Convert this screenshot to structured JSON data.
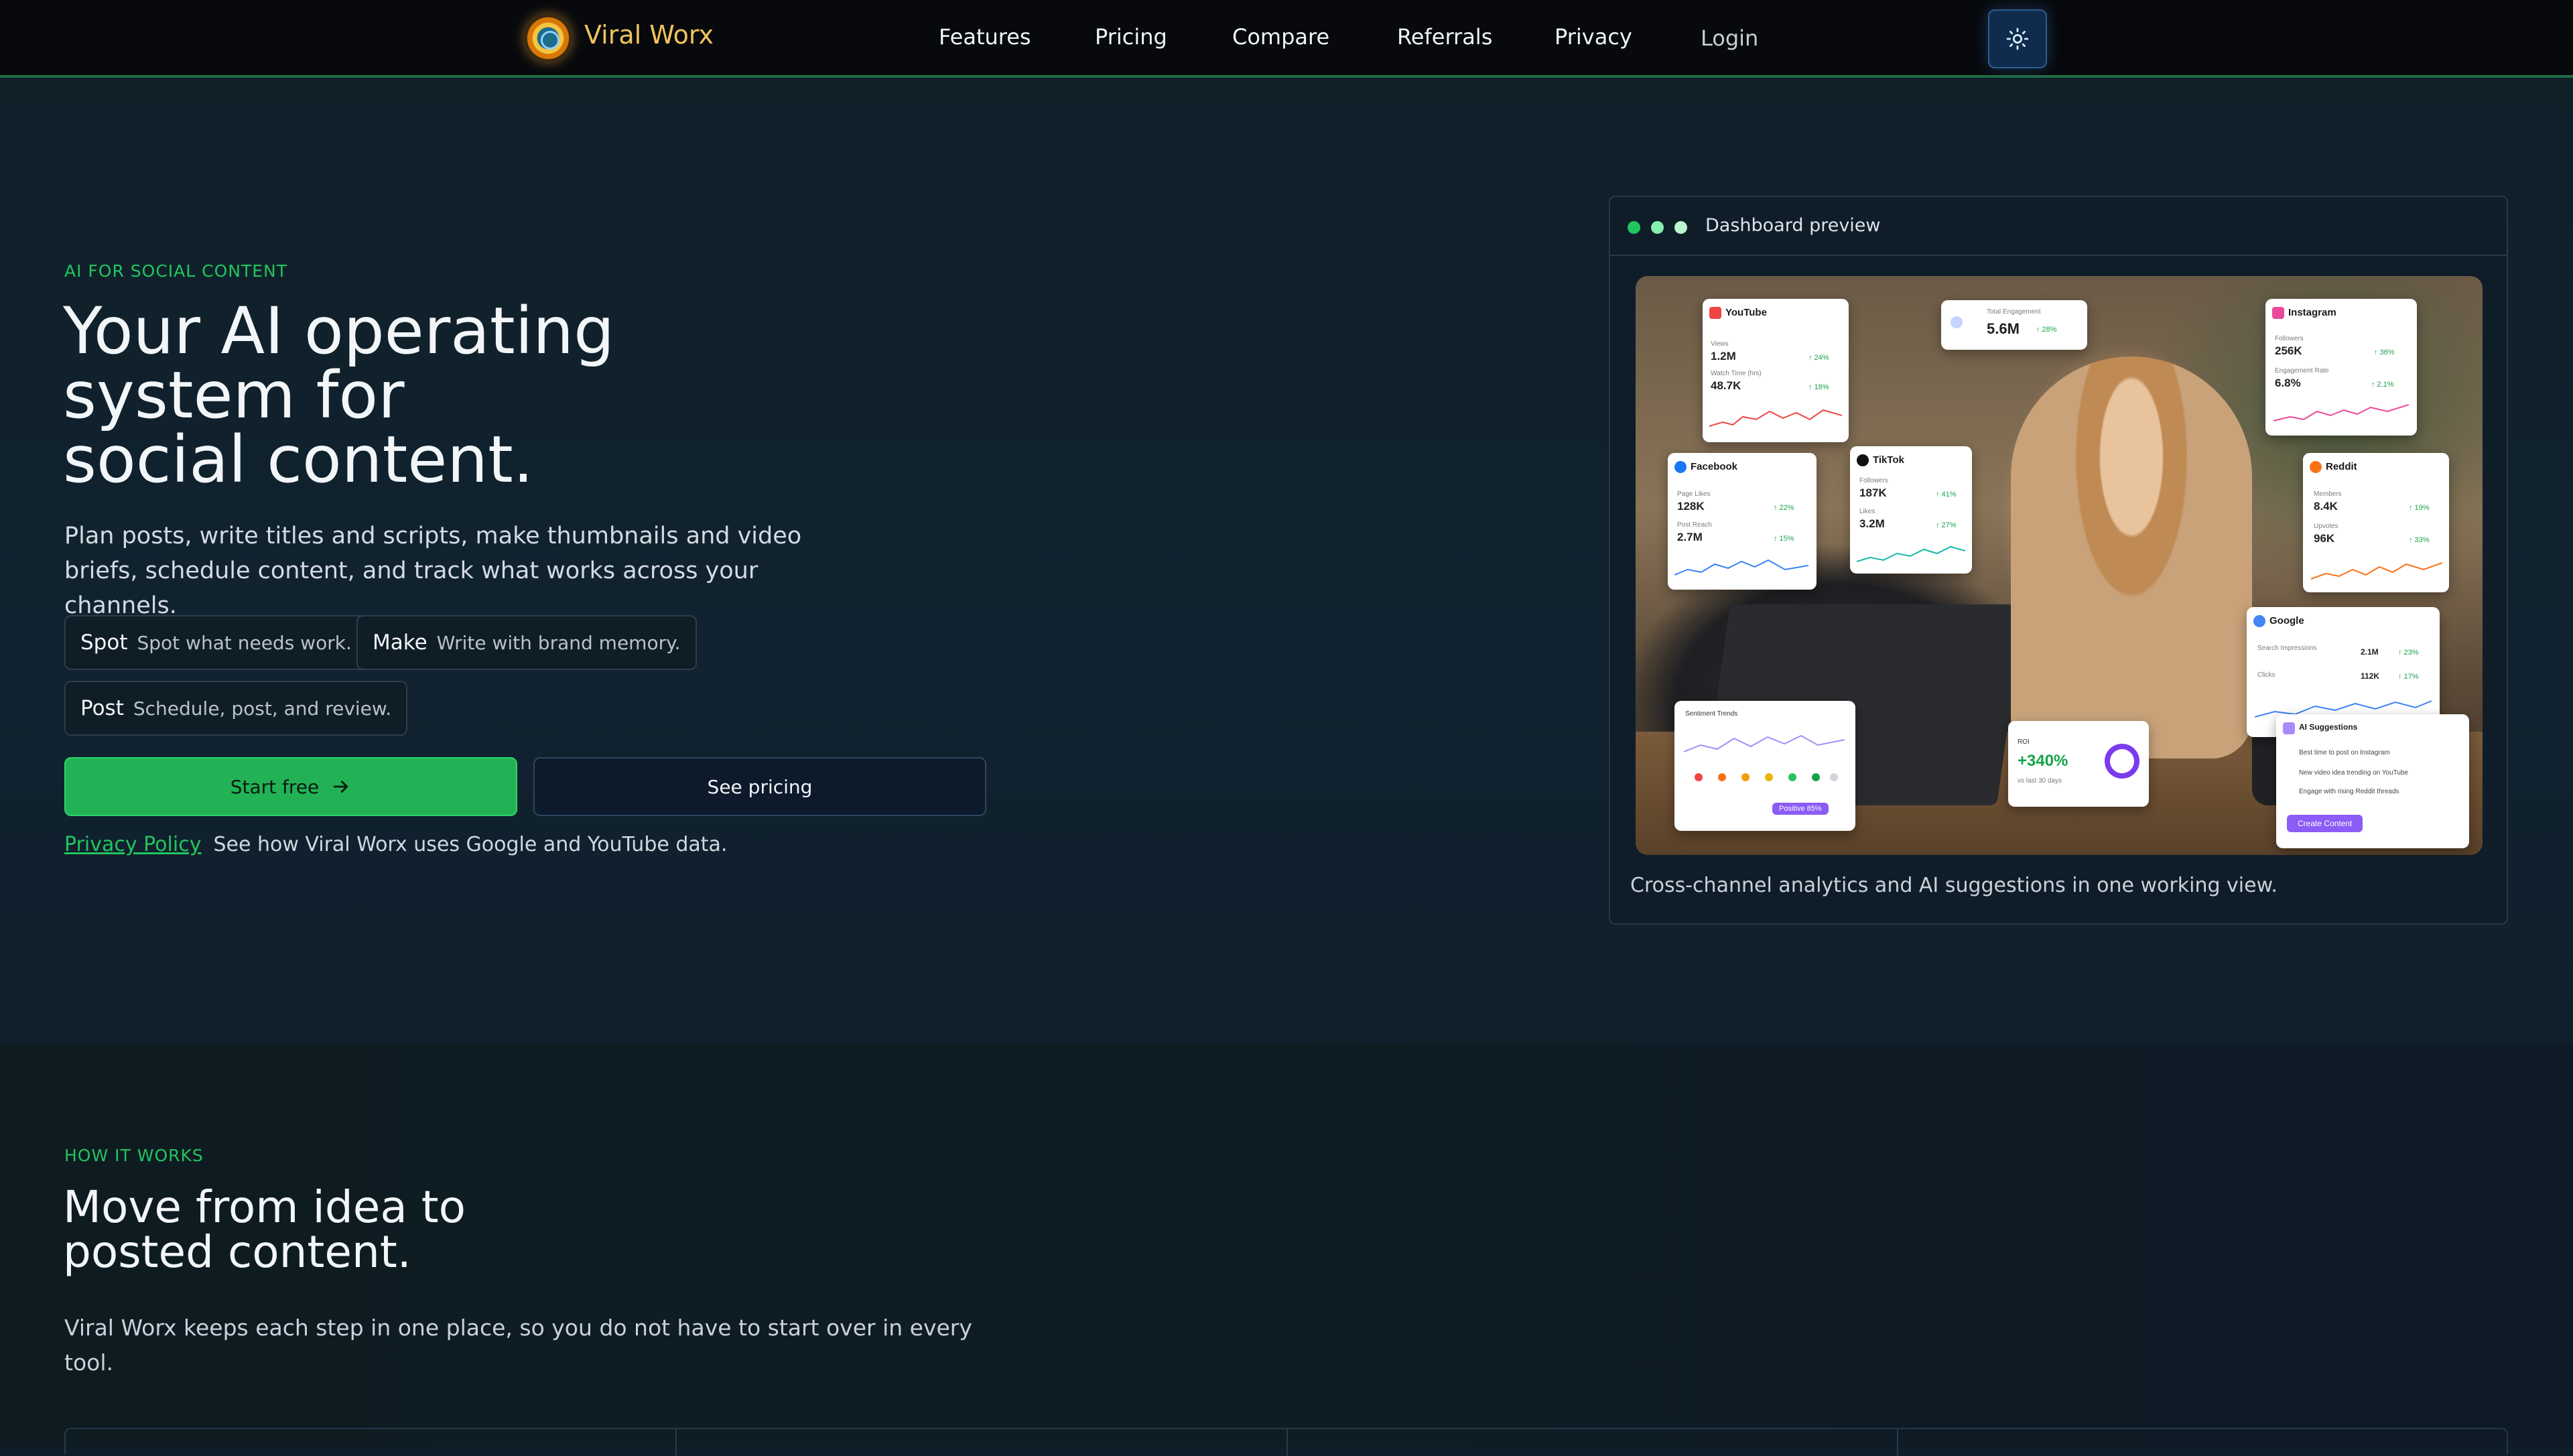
{
  "nav": {
    "brand": "Viral Worx",
    "links": [
      "Features",
      "Pricing",
      "Compare",
      "Referrals",
      "Privacy"
    ],
    "login": "Login",
    "theme_toggle_icon": "sun-icon"
  },
  "hero": {
    "eyebrow": "AI FOR SOCIAL CONTENT",
    "title_lines": [
      "Your AI operating",
      "system for",
      "social content."
    ],
    "lead": "Plan posts, write titles and scripts, make thumbnails and video briefs, schedule content, and track what works across your channels.",
    "pills": [
      {
        "key": "Spot",
        "text": "Spot what needs work."
      },
      {
        "key": "Make",
        "text": "Write with brand memory."
      },
      {
        "key": "Post",
        "text": "Schedule, post, and review."
      }
    ],
    "primary_cta": "Start free",
    "secondary_cta": "See pricing",
    "privacy_link": "Privacy Policy",
    "privacy_note": "See how Viral Worx uses Google and YouTube data."
  },
  "dashboard": {
    "title": "Dashboard preview",
    "caption": "Cross-channel analytics and AI suggestions in one working view.",
    "dot_colors": [
      "#22c55e",
      "#86efac",
      "#bbf7d0"
    ],
    "cards": {
      "youtube": {
        "name": "YouTube",
        "m1": "Views",
        "v1": "1.2M",
        "c1": "↑ 24%",
        "m2": "Watch Time (hrs)",
        "v2": "48.7K",
        "c2": "↑ 18%"
      },
      "total": {
        "label": "Total Engagement",
        "value": "5.6M",
        "change": "↑ 28%"
      },
      "instagram": {
        "name": "Instagram",
        "m1": "Followers",
        "v1": "256K",
        "c1": "↑ 36%",
        "m2": "Engagement Rate",
        "v2": "6.8%",
        "c2": "↑ 2.1%"
      },
      "facebook": {
        "name": "Facebook",
        "m1": "Page Likes",
        "v1": "128K",
        "c1": "↑ 22%",
        "m2": "Post Reach",
        "v2": "2.7M",
        "c2": "↑ 15%"
      },
      "tiktok": {
        "name": "TikTok",
        "m1": "Followers",
        "v1": "187K",
        "c1": "↑ 41%",
        "m2": "Likes",
        "v2": "3.2M",
        "c2": "↑ 27%"
      },
      "reddit": {
        "name": "Reddit",
        "m1": "Members",
        "v1": "8.4K",
        "c1": "↑ 19%",
        "m2": "Upvotes",
        "v2": "96K",
        "c2": "↑ 33%"
      },
      "google": {
        "name": "Google",
        "m1": "Search Impressions",
        "v1": "2.1M",
        "c1": "↑ 23%",
        "m2": "Clicks",
        "v2": "112K",
        "c2": "↑ 17%"
      },
      "sentiment": {
        "label": "Sentiment Trends",
        "badge": "Positive 85%"
      },
      "roi": {
        "label": "ROI",
        "value": "+340%",
        "sub": "vs last 30 days"
      },
      "ai": {
        "title": "AI Suggestions",
        "items": [
          "Best time to post on Instagram",
          "New video idea trending on YouTube",
          "Engage with rising Reddit threads"
        ],
        "button": "Create Content"
      }
    }
  },
  "how": {
    "eyebrow": "HOW IT WORKS",
    "title_lines": [
      "Move from idea to",
      "posted content."
    ],
    "lead": "Viral Worx keeps each step in one place, so you do not have to start over in every tool."
  },
  "colors": {
    "accent": "#22c55e",
    "brand": "#f2c35a",
    "background": "#0f1f2a"
  }
}
